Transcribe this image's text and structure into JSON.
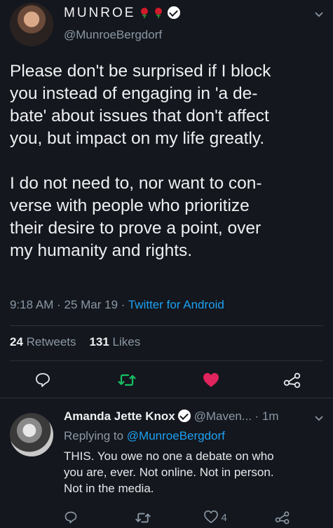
{
  "tweet": {
    "display_name": "MUNROE",
    "handle": "@MunroeBergdorf",
    "text": "Please don't be surprised if I block\nyou instead of engaging in 'a de-\nbate' about issues that don't affect\nyou, but impact on my life greatly.\n\nI do not need to, nor want to con-\nverse with people who prioritize\ntheir desire to prove a point, over\nmy humanity and rights.",
    "time": "9:18 AM",
    "sep1": " · ",
    "date": "25 Mar 19",
    "sep2": " · ",
    "source": "Twitter for Android",
    "retweets_count": "24",
    "retweets_label": "Retweets",
    "likes_count": "131",
    "likes_label": "Likes"
  },
  "reply": {
    "display_name": "Amanda Jette Knox",
    "handle": "@Maven...",
    "time": "· 1m",
    "replying_prefix": "Replying to",
    "replying_handle": "@MunroeBergdorf",
    "text": "THIS. You owe no one a debate on who\nyou are, ever. Not online. Not in person.\nNot in the media.",
    "like_count": "4"
  },
  "icons": {
    "reply": "reply-icon",
    "retweet": "retweet-icon",
    "like": "heart-icon",
    "share": "share-icon",
    "verified": "verified-icon",
    "rose": "rose-icon",
    "chevron": "chevron-down-icon"
  },
  "colors": {
    "background": "#14171d",
    "retweet_green": "#17bf63",
    "like_pink": "#e0245e",
    "link_blue": "#1da1f2",
    "muted": "#8b98a5"
  }
}
